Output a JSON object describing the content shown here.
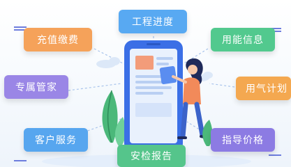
{
  "services": [
    {
      "key": "recharge",
      "label": "充值缴费",
      "color": "#f5a25a"
    },
    {
      "key": "project",
      "label": "工程进度",
      "color": "#58a9f2"
    },
    {
      "key": "info",
      "label": "用能信息",
      "color": "#52c98e"
    },
    {
      "key": "manager",
      "label": "专属管家",
      "color": "#9a86e6"
    },
    {
      "key": "gasplan",
      "label": "用气计划",
      "color": "#f4a850"
    },
    {
      "key": "service",
      "label": "客户服务",
      "color": "#57a6ef"
    },
    {
      "key": "inspect",
      "label": "安检报告",
      "color": "#55c58b"
    },
    {
      "key": "guide",
      "label": "指导价格",
      "color": "#8c7be3"
    }
  ],
  "colors": {
    "accent_dots": "#6d7ddd",
    "phone": "#3b6fe6",
    "screen": "#e9f1fd"
  }
}
